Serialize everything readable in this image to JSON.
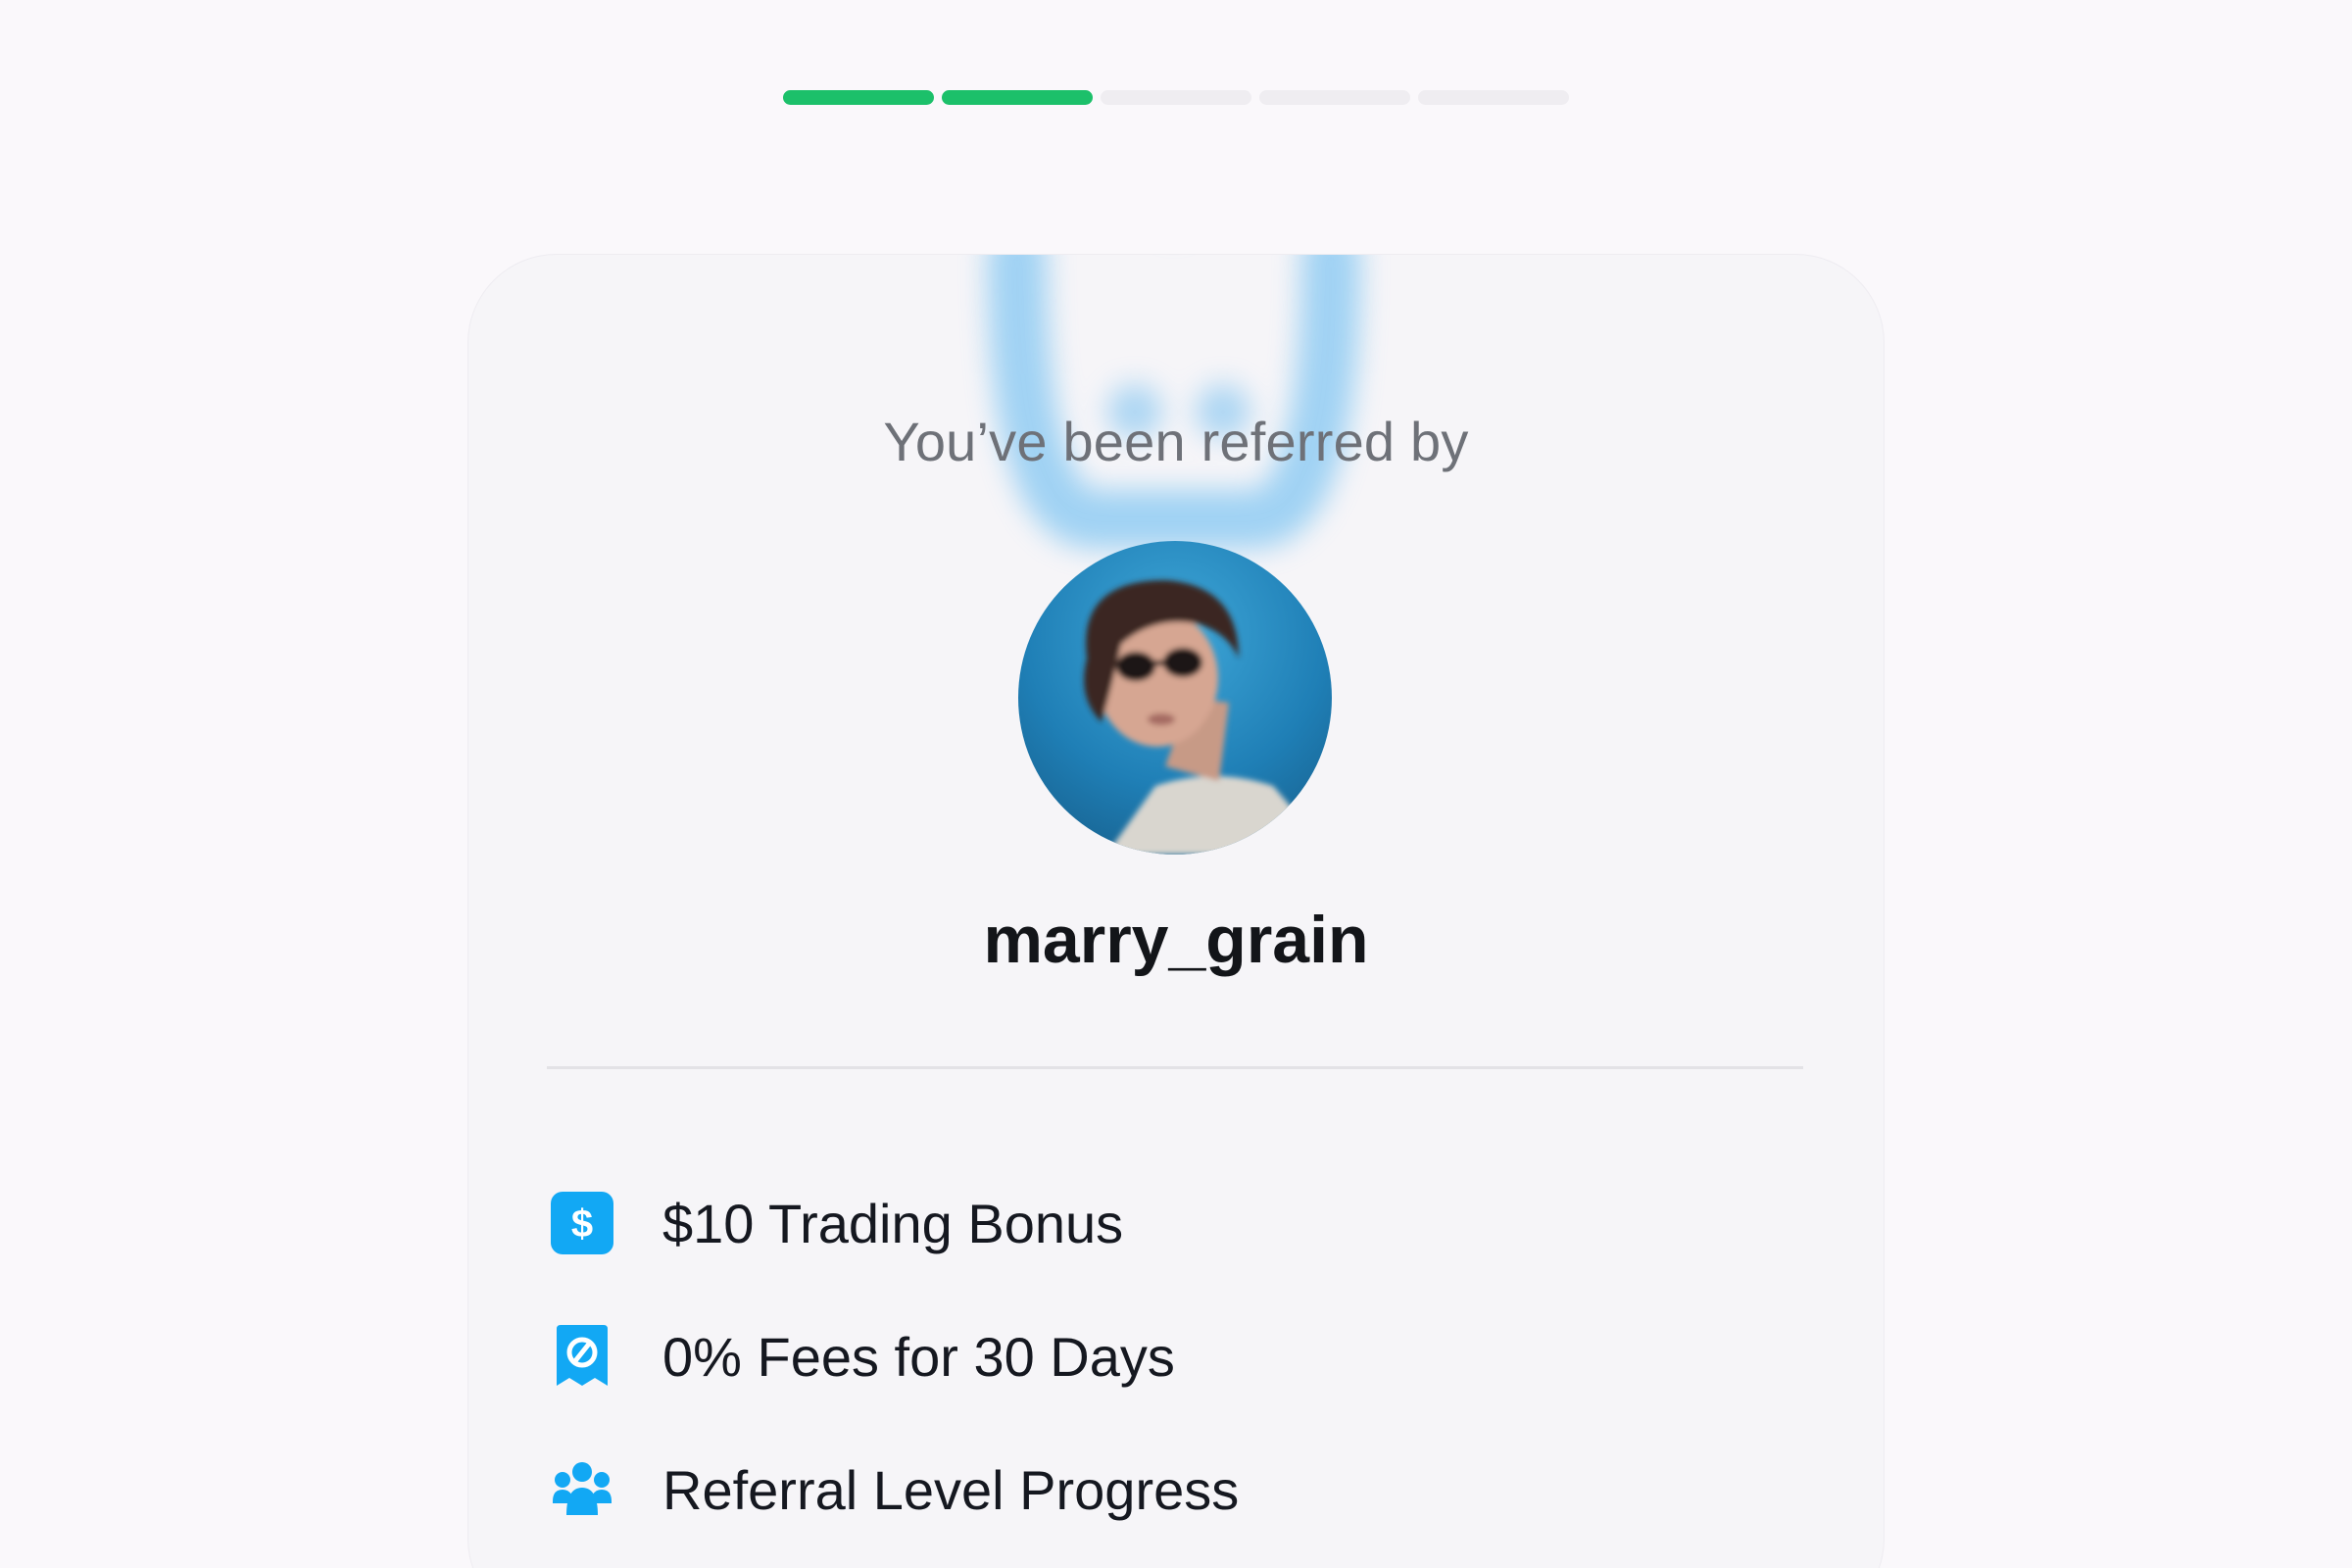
{
  "progress": {
    "total_steps": 5,
    "completed_steps": 2,
    "active_color": "#1cc06a",
    "inactive_color": "#efedf1"
  },
  "referral": {
    "heading": "You’ve been referred by",
    "avatar_icon": "profile-photo",
    "username": "marry_grain"
  },
  "perks": [
    {
      "icon": "dollar-badge-icon",
      "label": "$10 Trading Bonus"
    },
    {
      "icon": "receipt-zero-icon",
      "label": "0% Fees for 30 Days"
    },
    {
      "icon": "users-group-icon",
      "label": "Referral Level Progress"
    }
  ],
  "colors": {
    "icon_accent": "#12a8f4",
    "username": "#131519",
    "heading": "#6e7178"
  }
}
